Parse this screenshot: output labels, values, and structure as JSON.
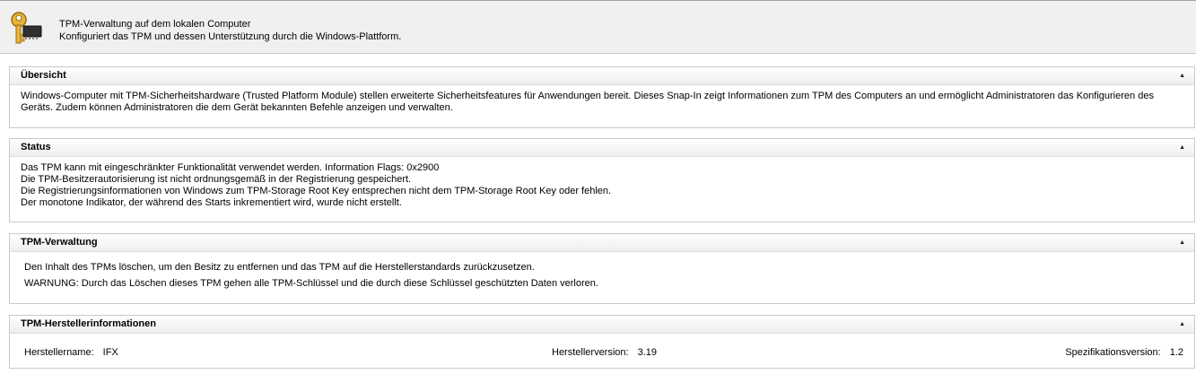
{
  "header": {
    "title": "TPM-Verwaltung auf dem lokalen Computer",
    "subtitle": "Konfiguriert das TPM und dessen Unterstützung durch die Windows-Plattform.",
    "icon": "key-chip-icon"
  },
  "overview": {
    "title": "Übersicht",
    "text": "Windows-Computer mit TPM-Sicherheitshardware (Trusted Platform Module) stellen erweiterte Sicherheitsfeatures für Anwendungen bereit. Dieses Snap-In zeigt Informationen zum TPM des Computers an und ermöglicht Administratoren das Konfigurieren des Geräts. Zudem können Administratoren die dem Gerät bekannten Befehle anzeigen und verwalten."
  },
  "status": {
    "title": "Status",
    "lines": [
      "Das TPM kann mit eingeschränkter Funktionalität verwendet werden. Information Flags: 0x2900",
      "Die TPM-Besitzerautorisierung ist nicht ordnungsgemäß in der Registrierung gespeichert.",
      "Die Registrierungsinformationen von Windows zum TPM-Storage Root Key entsprechen nicht dem TPM-Storage Root Key oder fehlen.",
      "Der monotone Indikator, der während des Starts inkrementiert wird, wurde nicht erstellt."
    ]
  },
  "management": {
    "title": "TPM-Verwaltung",
    "clear_text": "Den Inhalt des TPMs löschen, um den Besitz zu entfernen und das TPM auf die Herstellerstandards zurückzusetzen.",
    "warning": "WARNUNG: Durch das Löschen dieses TPM gehen alle TPM-Schlüssel und die durch diese Schlüssel geschützten Daten verloren."
  },
  "manufacturer": {
    "title": "TPM-Herstellerinformationen",
    "name_label": "Herstellername:",
    "name_value": "IFX",
    "version_label": "Herstellerversion:",
    "version_value": "3.19",
    "spec_label": "Spezifikationsversion:",
    "spec_value": "1.2"
  },
  "collapse_glyph": "▲"
}
